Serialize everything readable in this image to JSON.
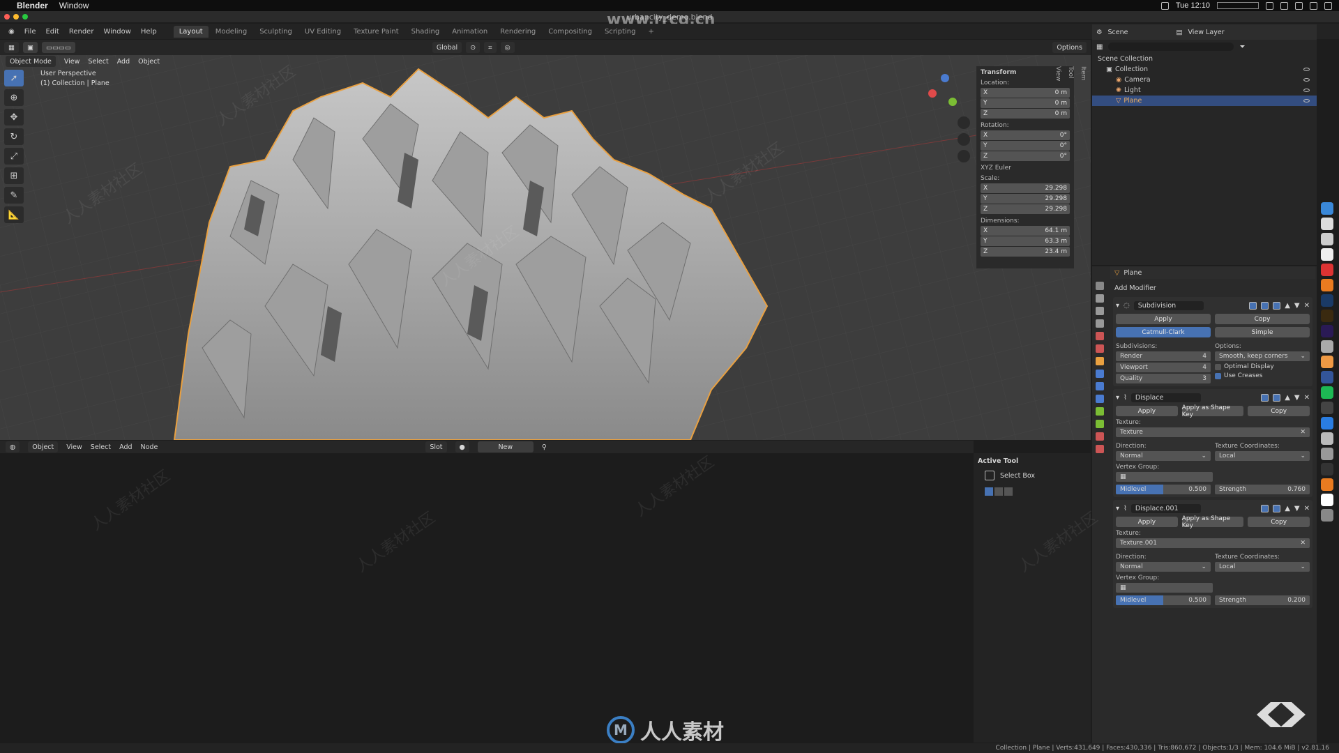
{
  "mac": {
    "apple": "",
    "app": "Blender",
    "menu": "Window",
    "clock": "Tue 12:10"
  },
  "window": {
    "title": "urbancity_demo.blend",
    "watermark_url": "www.rrcg.cn"
  },
  "menus": [
    "File",
    "Edit",
    "Render",
    "Window",
    "Help"
  ],
  "workspaces": [
    "Layout",
    "Modeling",
    "Sculpting",
    "UV Editing",
    "Texture Paint",
    "Shading",
    "Animation",
    "Rendering",
    "Compositing",
    "Scripting"
  ],
  "toolheader": {
    "orientation": "Global",
    "options": "Options"
  },
  "viewport": {
    "mode": "Object Mode",
    "menus": [
      "View",
      "Select",
      "Add",
      "Object"
    ],
    "perspective": "User Perspective",
    "collection_info": "(1) Collection | Plane"
  },
  "npanel": {
    "title": "Transform",
    "location_label": "Location:",
    "location": [
      {
        "a": "X",
        "v": "0 m"
      },
      {
        "a": "Y",
        "v": "0 m"
      },
      {
        "a": "Z",
        "v": "0 m"
      }
    ],
    "rotation_label": "Rotation:",
    "rotation": [
      {
        "a": "X",
        "v": "0°"
      },
      {
        "a": "Y",
        "v": "0°"
      },
      {
        "a": "Z",
        "v": "0°"
      }
    ],
    "rotation_mode": "XYZ Euler",
    "scale_label": "Scale:",
    "scale": [
      {
        "a": "X",
        "v": "29.298"
      },
      {
        "a": "Y",
        "v": "29.298"
      },
      {
        "a": "Z",
        "v": "29.298"
      }
    ],
    "dimensions_label": "Dimensions:",
    "dimensions": [
      {
        "a": "X",
        "v": "64.1 m"
      },
      {
        "a": "Y",
        "v": "63.3 m"
      },
      {
        "a": "Z",
        "v": "23.4 m"
      }
    ],
    "tabs": [
      "Item",
      "Tool",
      "View"
    ]
  },
  "nodeheader": {
    "mode": "Object",
    "menus": [
      "View",
      "Select",
      "Add",
      "Node"
    ],
    "slot": "Slot",
    "new": "New"
  },
  "activetool": {
    "title": "Active Tool",
    "tool": "Select Box"
  },
  "outliner": {
    "scene": "Scene",
    "view_layer": "View Layer",
    "root": "Scene Collection",
    "items": [
      {
        "name": "Collection",
        "color": "#cccccc"
      },
      {
        "name": "Camera",
        "color": "#e9a46a"
      },
      {
        "name": "Light",
        "color": "#e9a46a"
      },
      {
        "name": "Plane",
        "color": "#e9a46a"
      }
    ]
  },
  "properties": {
    "object": "Plane",
    "add_modifier": "Add Modifier",
    "subdivision": {
      "name": "Subdivision",
      "apply": "Apply",
      "copy": "Copy",
      "catmull": "Catmull-Clark",
      "simple": "Simple",
      "subdivisions_label": "Subdivisions:",
      "options_label": "Options:",
      "render_label": "Render",
      "render": "4",
      "viewport_label": "Viewport",
      "viewport": "4",
      "quality_label": "Quality",
      "quality": "3",
      "uv_smooth": "Smooth, keep corners",
      "optimal": "Optimal Display",
      "creases": "Use Creases"
    },
    "displace": {
      "name": "Displace",
      "apply": "Apply",
      "shape_key": "Apply as Shape Key",
      "copy": "Copy",
      "texture_label": "Texture:",
      "texture": "Texture",
      "direction_label": "Direction:",
      "direction": "Normal",
      "coords_label": "Texture Coordinates:",
      "coords": "Local",
      "vgroup_label": "Vertex Group:",
      "midlevel_label": "Midlevel",
      "midlevel": "0.500",
      "strength_label": "Strength",
      "strength": "0.760"
    },
    "displace2": {
      "name": "Displace.001",
      "apply": "Apply",
      "shape_key": "Apply as Shape Key",
      "copy": "Copy",
      "texture_label": "Texture:",
      "texture": "Texture.001",
      "direction_label": "Direction:",
      "direction": "Normal",
      "coords_label": "Texture Coordinates:",
      "coords": "Local",
      "vgroup_label": "Vertex Group:",
      "midlevel_label": "Midlevel",
      "midlevel": "0.500",
      "strength_label": "Strength",
      "strength": "0.200"
    }
  },
  "statusbar": "Collection | Plane | Verts:431,649 | Faces:430,336 | Tris:860,672 | Objects:1/3 | Mem: 104.6 MiB | v2.81.16",
  "logo_text": "人人素材",
  "watermark_text": "人人素材社区",
  "colors": {
    "accent": "#4772b3",
    "selection_outline": "#e9a040",
    "viewport_bg": "#3d3d3d"
  }
}
